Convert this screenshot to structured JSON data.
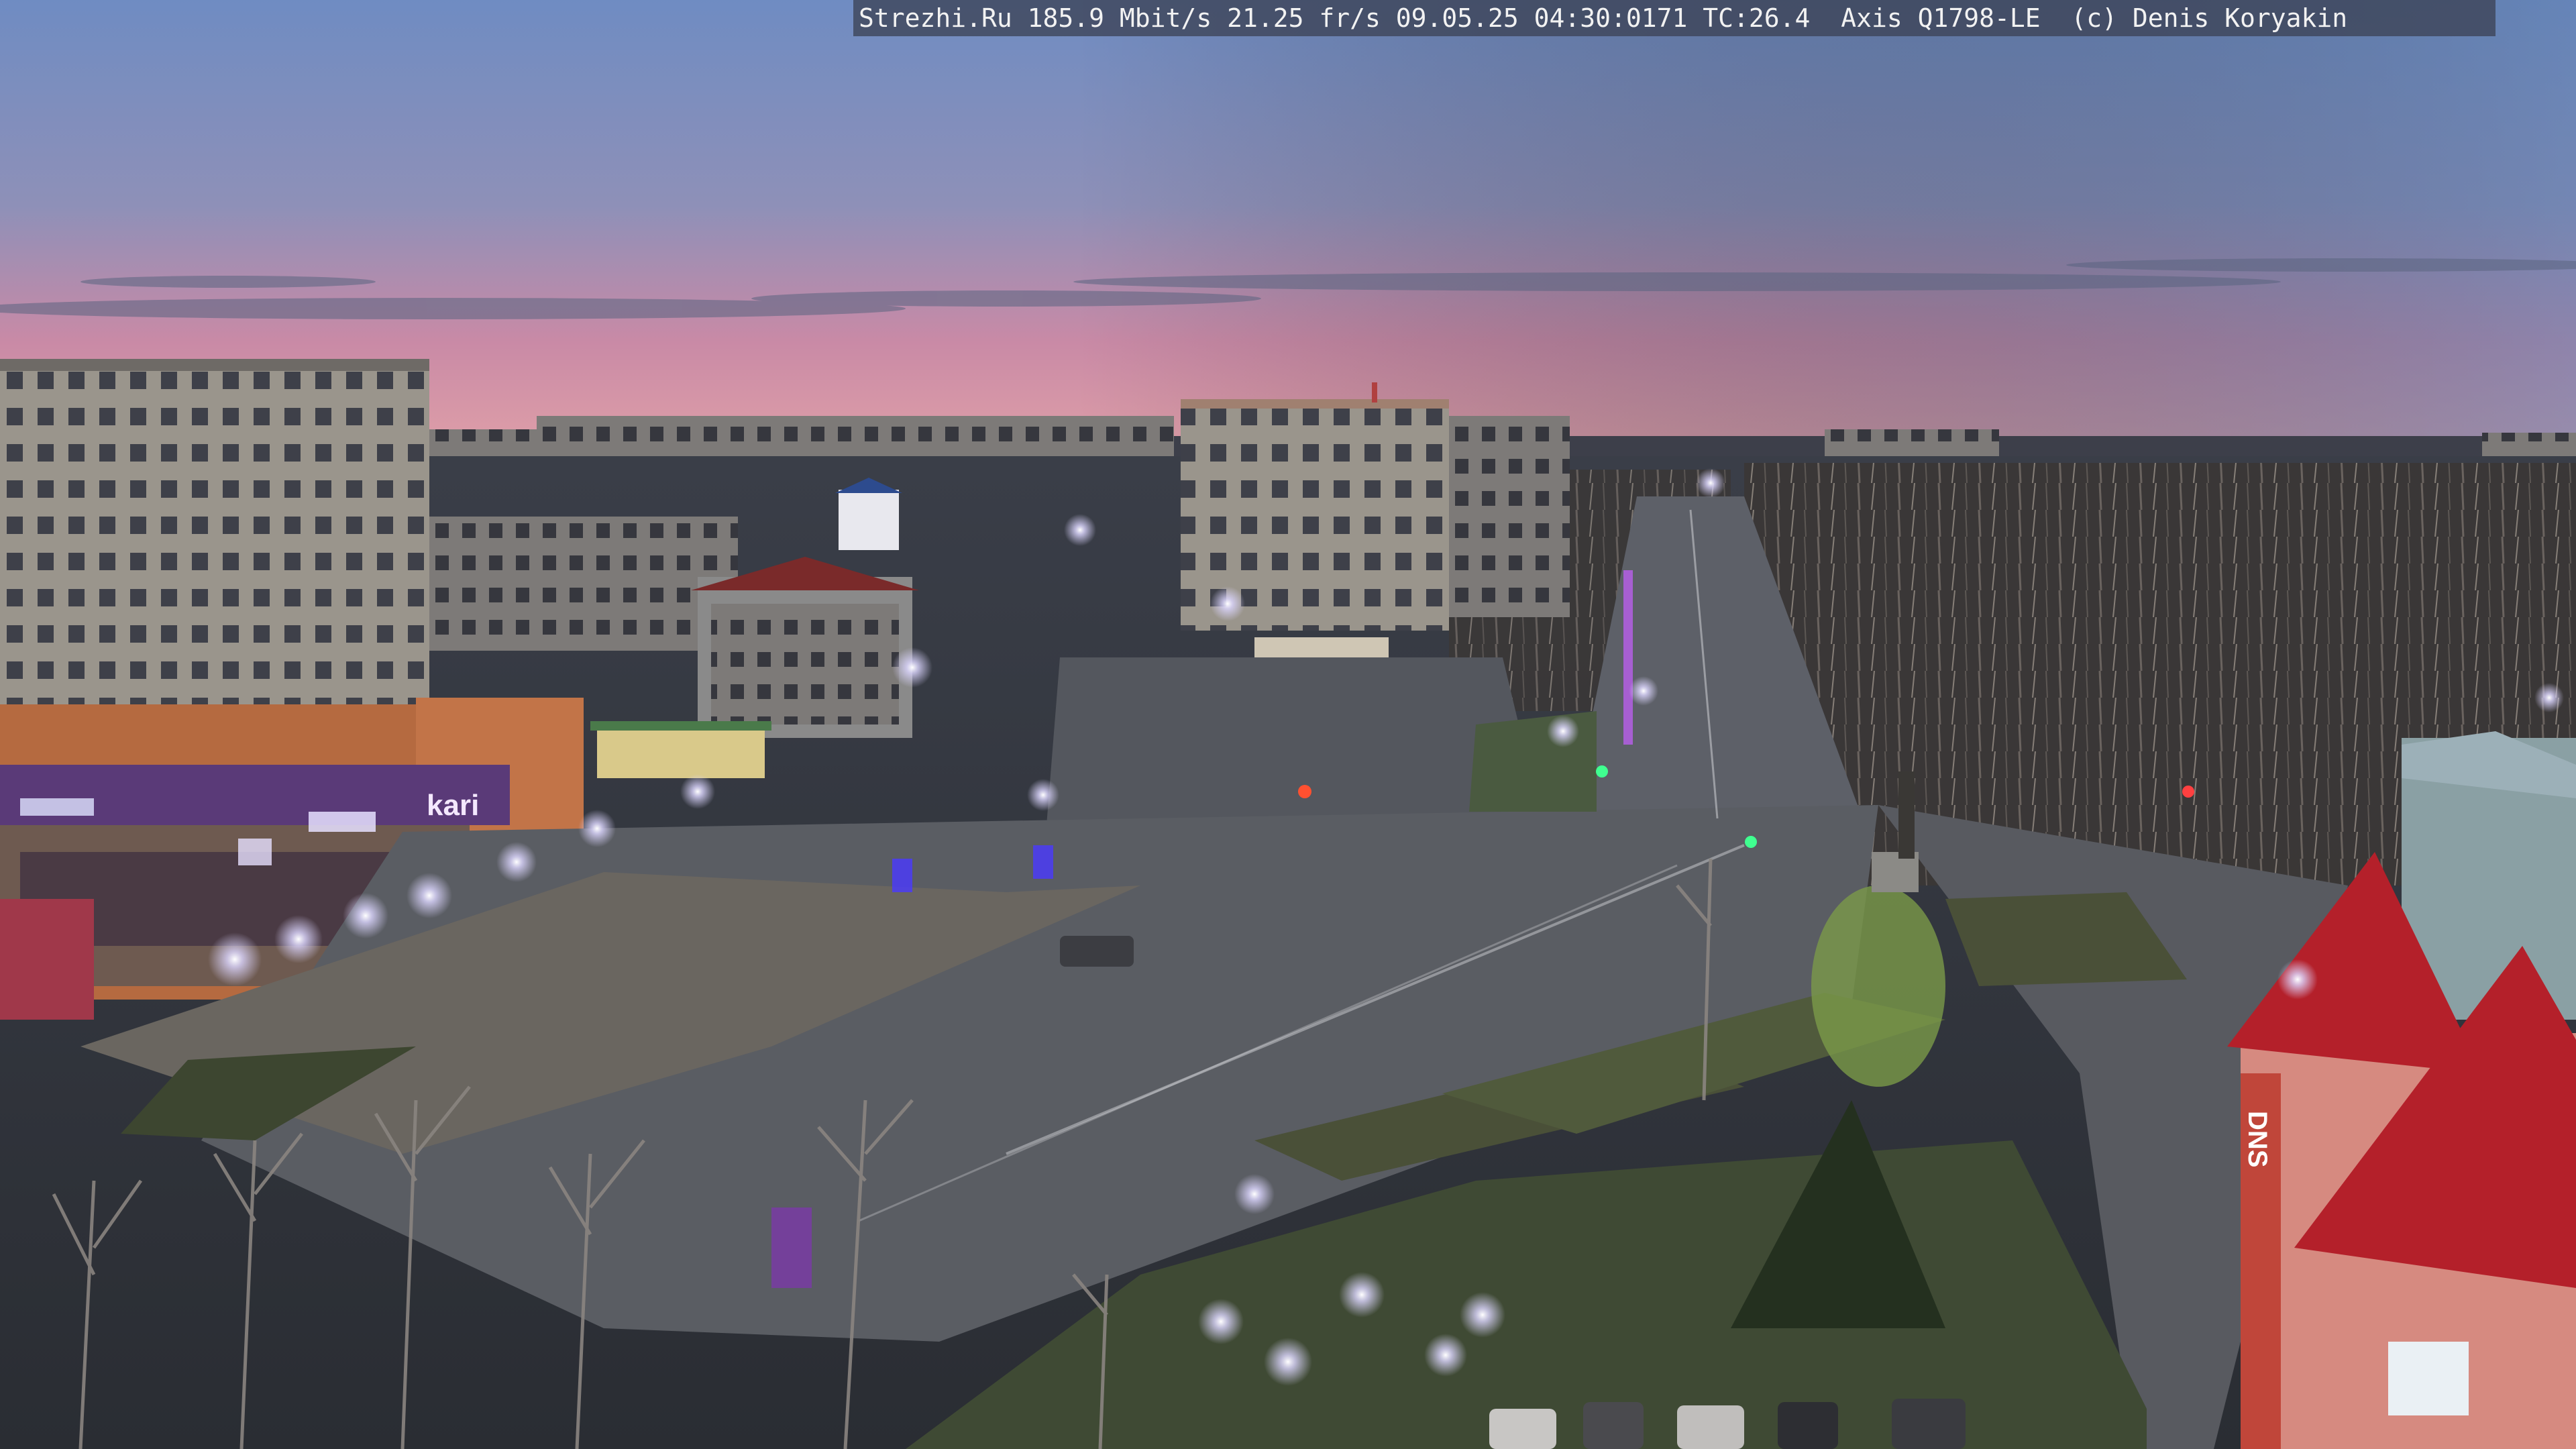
{
  "camera": {
    "overlay_text": "Strezhi.Ru 185.9 Mbit/s 21.25 fr/s 09.05.25 04:30:0171 TC:26.4  Axis Q1798-LE  (c) Denis Koryakin"
  },
  "signs": {
    "store_left": "kari",
    "store_right": "DNS"
  },
  "colors": {
    "sky_top": "#6f8cc2",
    "sky_horizon": "#d98aa0",
    "lamp_glow": "#dcd6ff",
    "roof_red": "#b4202a",
    "neon_purple": "#7a3aa8"
  }
}
